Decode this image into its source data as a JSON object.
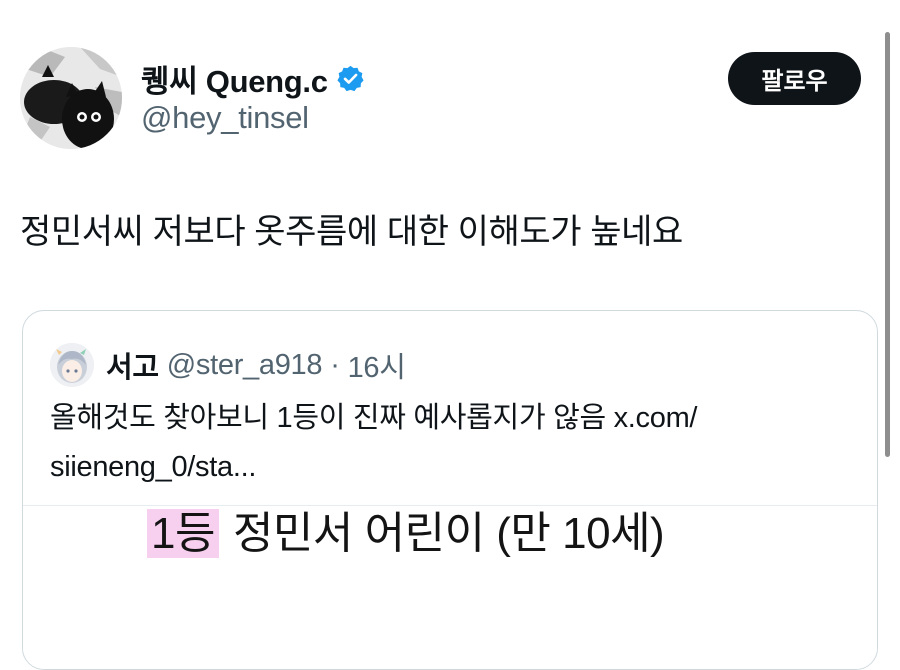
{
  "tweet": {
    "author": {
      "name": "퀭씨 Queng.c",
      "handle": "@hey_tinsel",
      "verified": true,
      "verified_color": "#1d9bf0"
    },
    "follow_label": "팔로우",
    "text": "정민서씨 저보다 옷주름에 대한 이해도가 높네요"
  },
  "quote": {
    "author": {
      "name": "서고",
      "handle": "@ster_a918"
    },
    "separator": "·",
    "time": "16시",
    "text_line1": "올해것도 찾아보니 1등이 진짜 예사롭지가 않음 x.com/",
    "text_line2": "siieneng_0/sta...",
    "media": {
      "rank": "1등",
      "caption": "정민서 어린이 (만 10세)",
      "highlight_color": "#f7d0ef"
    }
  },
  "colors": {
    "text": "#0f1419",
    "secondary_text": "#536471",
    "follow_bg": "#0f1419",
    "border": "#cfd9de"
  },
  "icons": {
    "verified": "verified-badge-icon",
    "avatar": "cat-illustration-avatar",
    "quote_avatar": "anime-character-avatar"
  }
}
